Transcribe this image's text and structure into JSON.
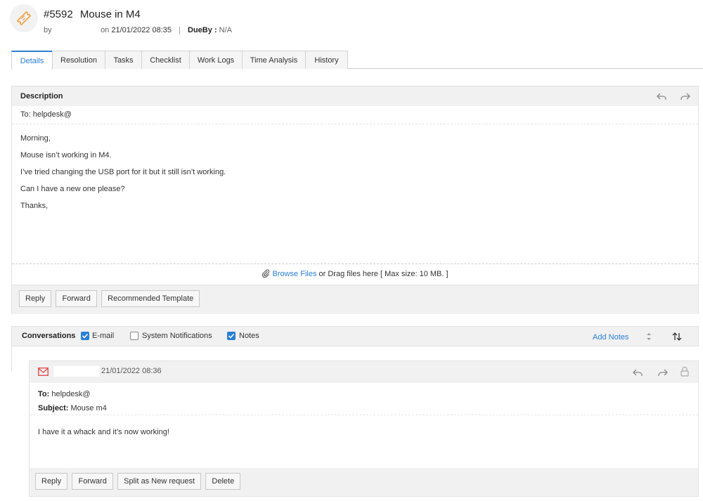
{
  "header": {
    "ticket_id": "#5592",
    "subject": "Mouse in M4",
    "by_label": "by",
    "on_label": "on",
    "created_date": "21/01/2022 08:35",
    "separator": "|",
    "dueby_label": "DueBy :",
    "dueby_value": "N/A",
    "icon": "ticket-icon"
  },
  "tabs": [
    {
      "label": "Details",
      "active": true
    },
    {
      "label": "Resolution",
      "active": false
    },
    {
      "label": "Tasks",
      "active": false
    },
    {
      "label": "Checklist",
      "active": false
    },
    {
      "label": "Work Logs",
      "active": false
    },
    {
      "label": "Time Analysis",
      "active": false
    },
    {
      "label": "History",
      "active": false
    }
  ],
  "description": {
    "title": "Description",
    "to_line": "To: helpdesk@",
    "body": [
      "Morning,",
      "Mouse isn’t working in M4.",
      "I’ve tried changing the USB port for it but it still isn’t working.",
      "Can I have a new one please?",
      "Thanks,"
    ],
    "attach": {
      "link_text": "Browse Files",
      "rest_text": "or Drag files here [ Max size: 10 MB. ]"
    },
    "actions": {
      "reply": "Reply",
      "forward": "Forward",
      "template": "Recommended Template"
    }
  },
  "conversations": {
    "label": "Conversations",
    "filters": [
      {
        "label": "E-mail",
        "checked": true
      },
      {
        "label": "System Notifications",
        "checked": false
      },
      {
        "label": "Notes",
        "checked": true
      }
    ],
    "add_notes": "Add Notes"
  },
  "conversation_item": {
    "date": "21/01/2022 08:36",
    "to_label": "To:",
    "to_value": "helpdesk@",
    "subject_label": "Subject:",
    "subject_value": "Mouse m4",
    "body": "I have it a whack and it’s now working!",
    "actions": {
      "reply": "Reply",
      "forward": "Forward",
      "split": "Split as New request",
      "delete": "Delete"
    }
  },
  "colors": {
    "accent": "#2a7fd4",
    "ticket_icon": "#f0a040",
    "mail_icon": "#e04545"
  }
}
